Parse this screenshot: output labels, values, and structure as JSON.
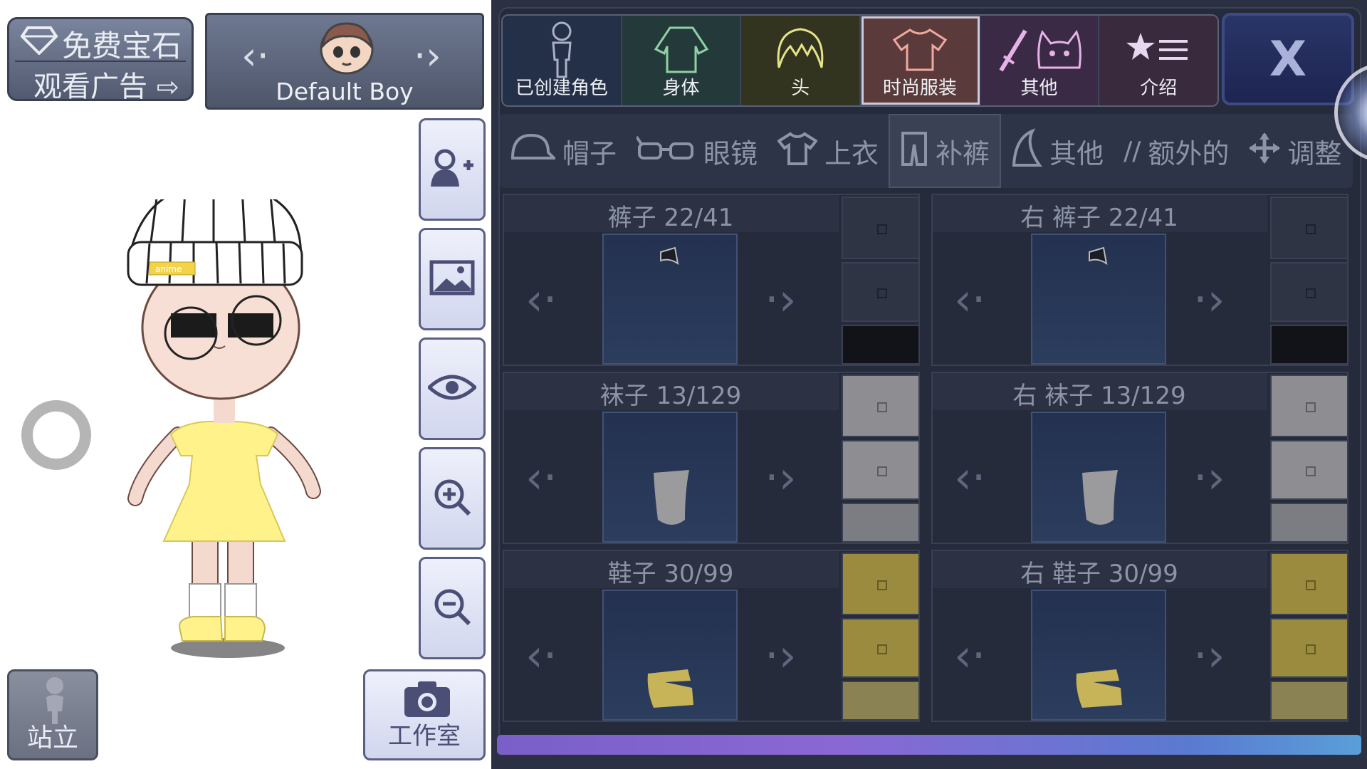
{
  "gem_box": {
    "line1": "免费宝石",
    "line2": "观看广告"
  },
  "character": {
    "name": "Default Boy",
    "prev_icon": "chevron-left-dotted",
    "next_icon": "chevron-right-dotted"
  },
  "tools": {
    "add_user_icon": "add-user",
    "background_icon": "image",
    "visibility_icon": "eye",
    "zoom_in_icon": "zoom-in",
    "zoom_out_icon": "zoom-out"
  },
  "stand_button": {
    "label": "站立"
  },
  "studio_button": {
    "label": "工作室"
  },
  "character_sticker_text": "anime",
  "main_tabs": [
    {
      "label": "已创建角色",
      "icon": "person"
    },
    {
      "label": "身体",
      "icon": "shirt-outline"
    },
    {
      "label": "头",
      "icon": "hair"
    },
    {
      "label": "时尚服装",
      "icon": "tshirt",
      "active": true
    },
    {
      "label": "其他",
      "icon": "sword-cat"
    },
    {
      "label": "介绍",
      "icon": "star-list"
    }
  ],
  "close_label": "X",
  "sub_tabs": [
    {
      "label": "帽子",
      "icon": "cap"
    },
    {
      "label": "眼镜",
      "icon": "glasses"
    },
    {
      "label": "上衣",
      "icon": "shirt"
    },
    {
      "label": "补裤",
      "icon": "pants",
      "active": true
    },
    {
      "label": "其他",
      "icon": "other"
    },
    {
      "label": "额外的",
      "icon": "slash"
    },
    {
      "label": "调整",
      "icon": "move"
    }
  ],
  "slots": [
    {
      "title": "裤子 22/41",
      "swatches": [
        "#2f3444",
        "#2f3444",
        "#111318"
      ]
    },
    {
      "title": "右 裤子 22/41",
      "swatches": [
        "#2f3444",
        "#2f3444",
        "#111318"
      ]
    },
    {
      "title": "袜子 13/129",
      "swatches": [
        "#8e8e92",
        "#8e8e92",
        "#7c7d82"
      ]
    },
    {
      "title": "右 袜子 13/129",
      "swatches": [
        "#8e8e92",
        "#8e8e92",
        "#7c7d82"
      ]
    },
    {
      "title": "鞋子 30/99",
      "swatches": [
        "#9a8b3e",
        "#9a8b3e",
        "#8a8252"
      ]
    },
    {
      "title": "右 鞋子 30/99",
      "swatches": [
        "#9a8b3e",
        "#9a8b3e",
        "#8a8252"
      ]
    }
  ]
}
